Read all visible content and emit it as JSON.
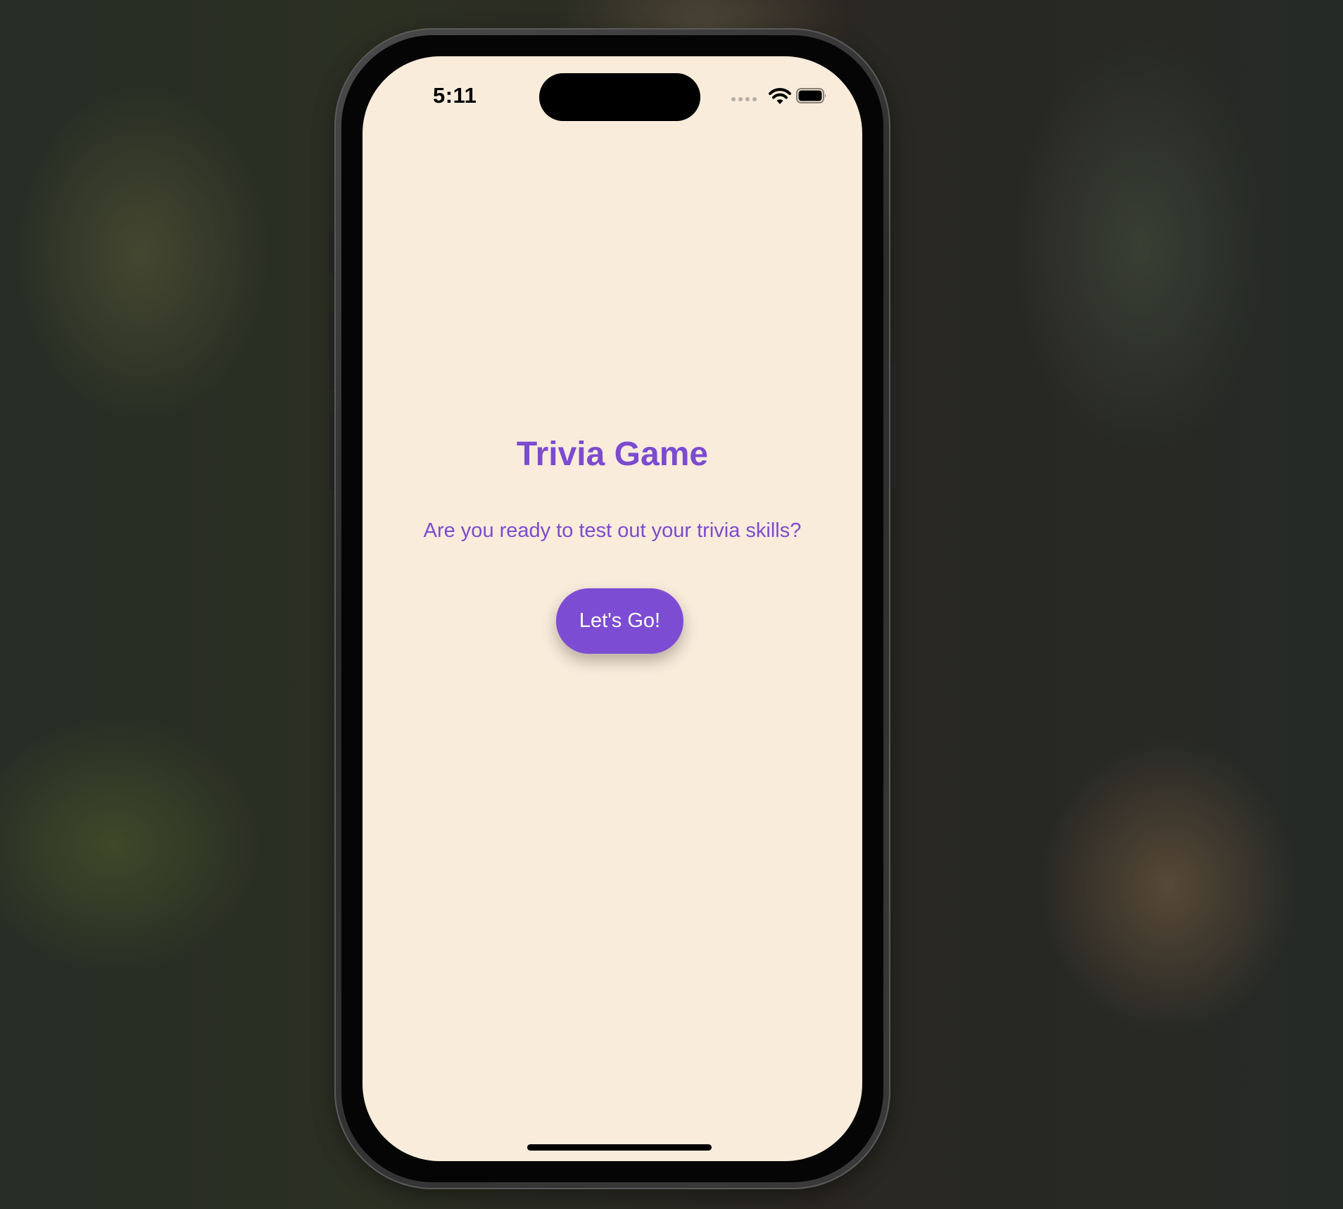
{
  "status_bar": {
    "time": "5:11",
    "icons": [
      "cellular-signal-icon",
      "wifi-icon",
      "battery-icon"
    ]
  },
  "app": {
    "title": "Trivia Game",
    "subtitle": "Are you ready to test out your trivia skills?",
    "start_button_label": "Let's Go!"
  },
  "colors": {
    "background": "#faecdb",
    "accent": "#7c4dd3",
    "button_text": "#ffffff"
  }
}
